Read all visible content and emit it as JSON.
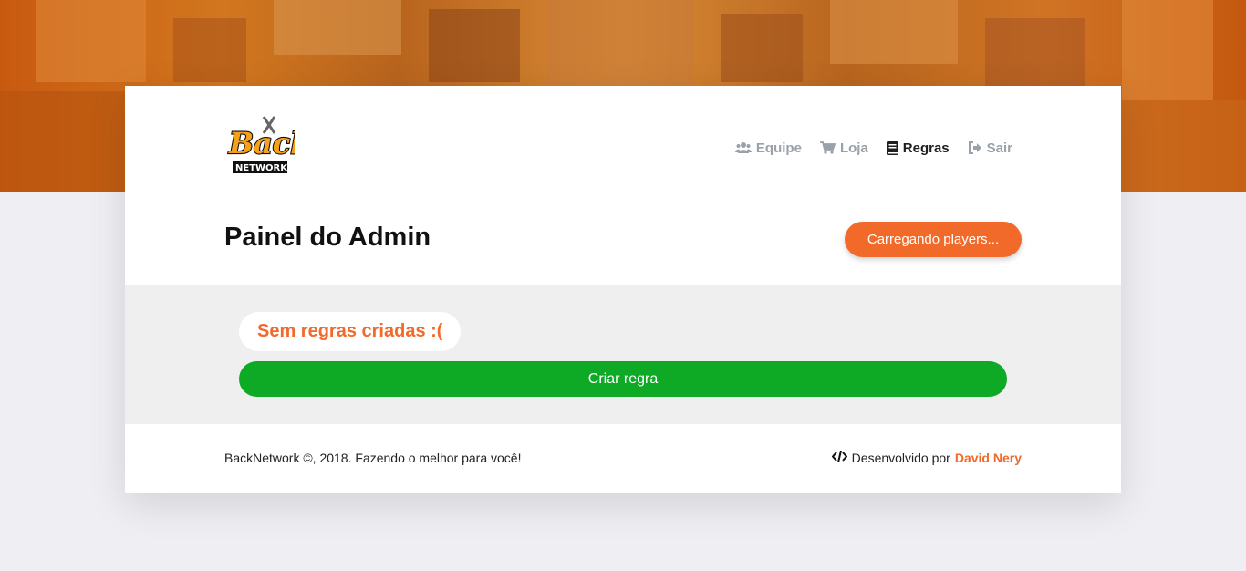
{
  "colors": {
    "accent": "#f26a2a",
    "success": "#0eaa26",
    "banner": "#c85a10",
    "background": "#efeff3"
  },
  "header": {
    "logo_alt": "Back Network logo",
    "nav": [
      {
        "label": "Equipe",
        "icon": "users-icon",
        "active": false
      },
      {
        "label": "Loja",
        "icon": "cart-icon",
        "active": false
      },
      {
        "label": "Regras",
        "icon": "book-icon",
        "active": true
      },
      {
        "label": "Sair",
        "icon": "sign-out-icon",
        "active": false
      }
    ]
  },
  "main": {
    "title": "Painel do Admin",
    "load_button": "Carregando players...",
    "empty_message": "Sem regras criadas :(",
    "create_button": "Criar regra"
  },
  "footer": {
    "copyright": "BackNetwork ©, 2018. Fazendo o melhor para você!",
    "dev_prefix": "Desenvolvido por",
    "dev_name": "David Nery",
    "dev_icon": "code-icon"
  }
}
